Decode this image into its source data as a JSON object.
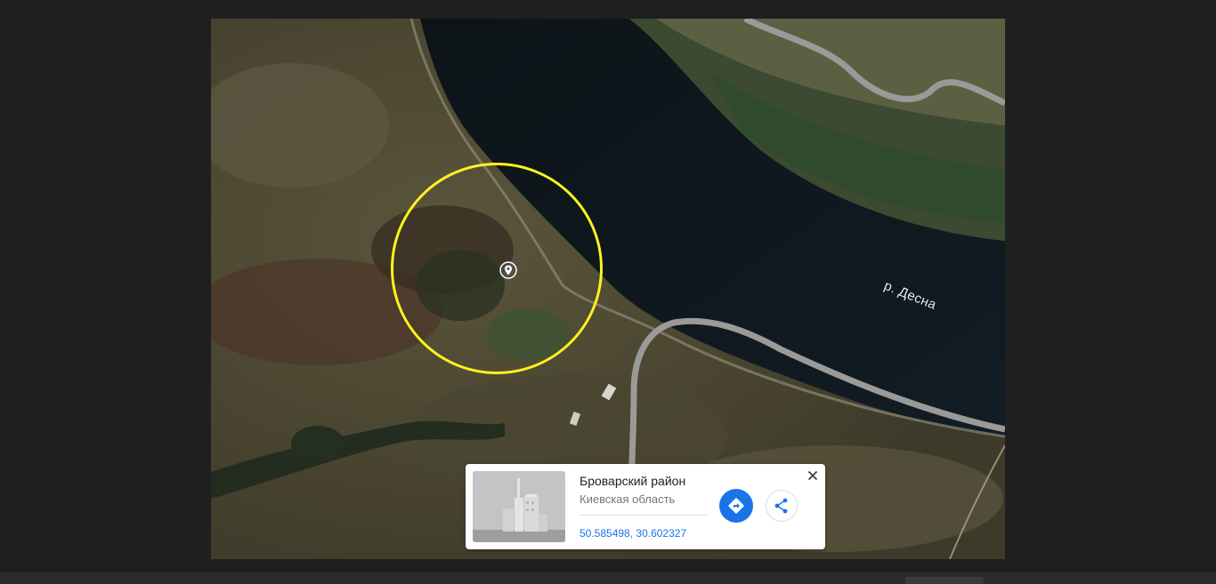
{
  "map": {
    "view": "satellite",
    "river_label": "р. Десна"
  },
  "place_card": {
    "title": "Броварский район",
    "subtitle": "Киевская область",
    "coordinates": "50.585498, 30.602327",
    "thumbnail_icon": "city-buildings-icon",
    "accent_color": "#1a73e8"
  },
  "highlight": {
    "color": "#fff21f"
  }
}
